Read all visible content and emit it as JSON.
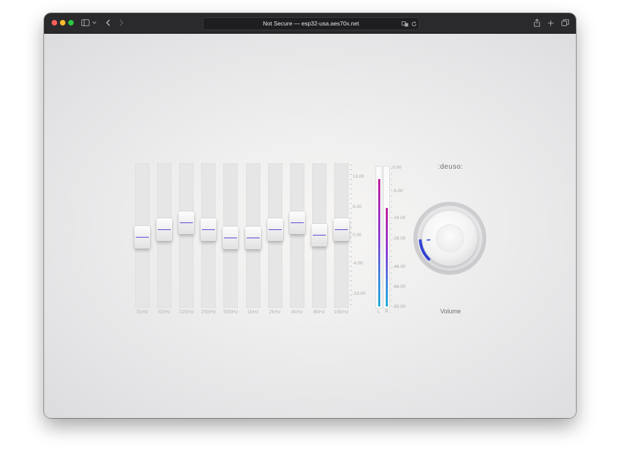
{
  "browser": {
    "address": "Not Secure — esp32-usa.aes70x.net",
    "traffic_lights": {
      "close": "#fe5f57",
      "minimize": "#febc2e",
      "zoom": "#28c840"
    },
    "icons": [
      "sidebar-icon",
      "chevron-down-icon",
      "back-icon",
      "forward-icon",
      "translate-icon",
      "reload-icon",
      "share-icon",
      "plus-icon",
      "tabs-icon"
    ]
  },
  "brand": {
    "logo": ":deuso:"
  },
  "equalizer": {
    "bands": [
      {
        "label": "31Hz",
        "gain_db": -0.5
      },
      {
        "label": "62Hz",
        "gain_db": 1.2
      },
      {
        "label": "125Hz",
        "gain_db": 2.7
      },
      {
        "label": "250Hz",
        "gain_db": 1.2
      },
      {
        "label": "500Hz",
        "gain_db": -0.6
      },
      {
        "label": "1kHz",
        "gain_db": -0.6
      },
      {
        "label": "2kHz",
        "gain_db": 1.2
      },
      {
        "label": "4kHz",
        "gain_db": 2.7
      },
      {
        "label": "8kHz",
        "gain_db": 0.0
      },
      {
        "label": "16kHz",
        "gain_db": 1.2
      }
    ],
    "scale_labels": [
      "13.00",
      "6.00",
      "0.00",
      "-6.00",
      "-13.00"
    ],
    "range_db": [
      -13,
      13
    ]
  },
  "meter": {
    "channels": [
      {
        "label": "L",
        "level_fraction": 0.92
      },
      {
        "label": "R",
        "level_fraction": 0.71
      }
    ],
    "scale_labels": [
      "0.00",
      "-6.00",
      "-16.00",
      "-26.00",
      "-46.00",
      "-66.00",
      "-90.00"
    ],
    "colors": {
      "top": "#c21c9a",
      "bottom": "#1aa8d8"
    }
  },
  "volume": {
    "label": "Volume",
    "level_fraction": 0.15,
    "accent_color": "#3046e0"
  }
}
